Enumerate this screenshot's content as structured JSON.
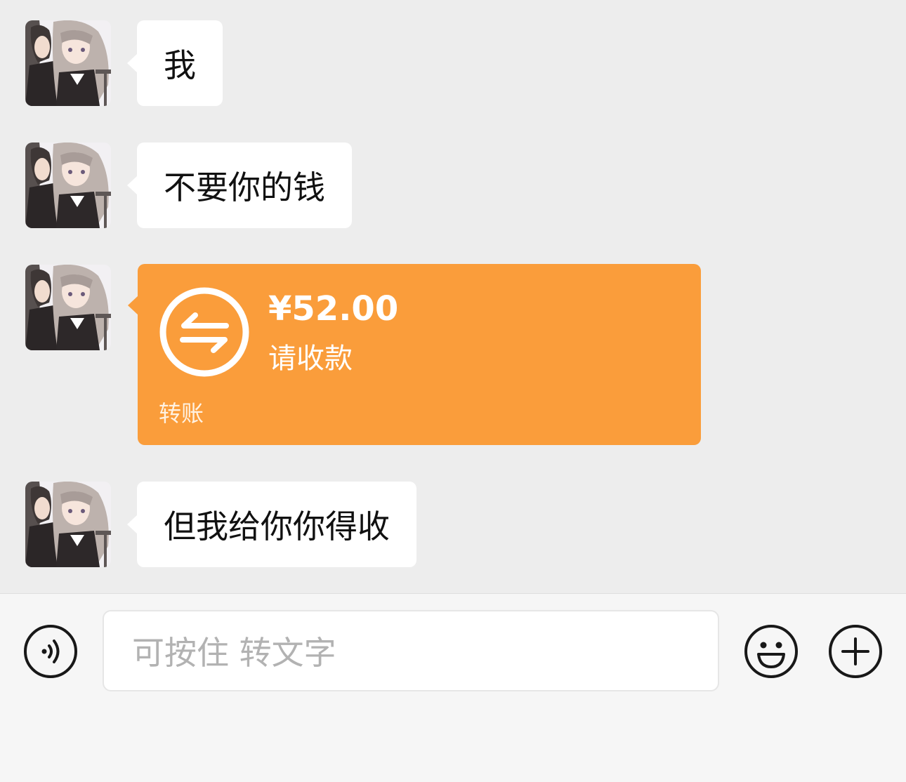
{
  "messages": [
    {
      "type": "text",
      "text": "我"
    },
    {
      "type": "text",
      "text": "不要你的钱"
    },
    {
      "type": "transfer",
      "amount": "¥52.00",
      "status": "请收款",
      "label": "转账",
      "color": "#fa9d3b"
    },
    {
      "type": "text",
      "text": "但我给你你得收"
    }
  ],
  "input": {
    "placeholder": "可按住 转文字"
  },
  "icons": {
    "voice": "voice-icon",
    "emoji": "emoji-icon",
    "plus": "plus-icon",
    "transfer": "transfer-arrows-icon"
  },
  "colors": {
    "chat_background": "#ededed",
    "bubble": "#ffffff",
    "transfer_card": "#fa9d3b",
    "input_bar": "#f6f6f6"
  }
}
